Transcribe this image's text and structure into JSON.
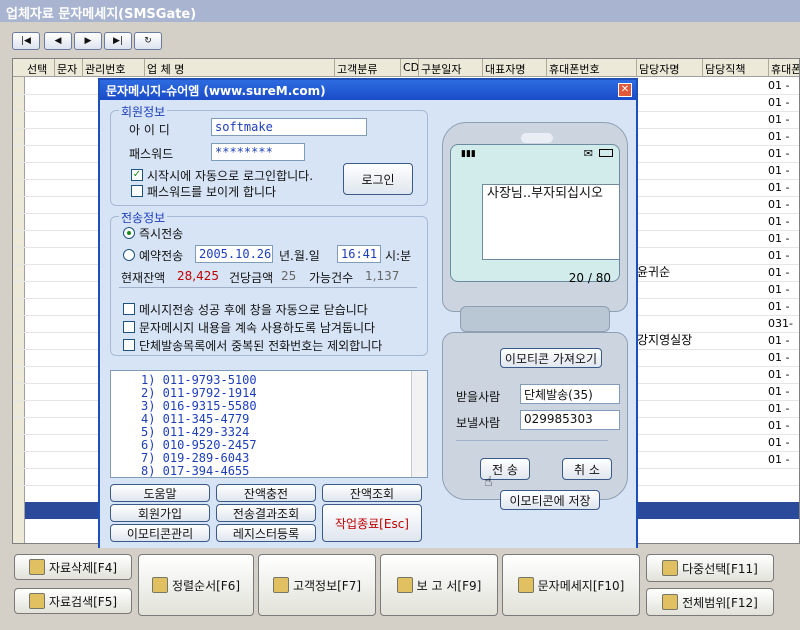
{
  "window": {
    "title": "업체자료 문자메세지(SMSGate)"
  },
  "nav": {
    "first": "|◀",
    "prev": "◀",
    "next": "▶",
    "last": "▶|",
    "refresh": "↻"
  },
  "grid": {
    "columns": [
      "선택",
      "문자",
      "관리번호",
      "업 체 명",
      "고객분류",
      "CD",
      "구분일자",
      "대표자명",
      "휴대폰번호",
      "담당자명",
      "담당직책",
      "휴대폰"
    ],
    "right_col_values": [
      "01 -",
      "01 -",
      "01 -",
      "01 -",
      "01 -",
      "01 -",
      "01 -",
      "01 -",
      "01 -",
      "01 -",
      "01 -",
      "01 -",
      "01 -",
      "01 -",
      "031-",
      "01 -",
      "01 -",
      "01 -",
      "01 -",
      "01 -",
      "01 -",
      "01 -",
      "01 -",
      "01 -"
    ],
    "visible_names": {
      "row_11": "윤귀순",
      "row_15": "강지영실장"
    }
  },
  "dialog": {
    "title": "문자메시지-슈어엠 (www.sureM.com)",
    "member": {
      "group_label": "회원정보",
      "id_label": "아 이 디",
      "id_value": "softmake",
      "pw_label": "패스워드",
      "pw_value": "********",
      "auto_login": "시작시에 자동으로 로그인합니다.",
      "show_pw": "패스워드를 보이게 합니다",
      "login_btn": "로그인"
    },
    "send": {
      "group_label": "전송정보",
      "immediate": "즉시전송",
      "reserve": "예약전송",
      "date": "2005.10.26",
      "date_fmt": "년.월.일",
      "time": "16:41",
      "time_fmt": "시:분",
      "balance_label": "현재잔액",
      "balance": "28,425",
      "unit_label": "건당금액",
      "unit": "25",
      "count_label": "가능건수",
      "count": "1,137",
      "opt1": "메시지전송 성공 후에 창을 자동으로 닫습니다",
      "opt2": "문자메시지 내용을 계속 사용하도록 남겨둡니다",
      "opt3": "단체발송목록에서 중복된 전화번호는 제외합니다"
    },
    "list": [
      "1)   011-9793-5100",
      "2)   011-9792-1914",
      "3)   016-9315-5580",
      "4)   011-345-4779",
      "5)   011-429-3324",
      "6)   010-9520-2457",
      "7)   019-289-6043",
      "8)   017-394-4655"
    ],
    "buttons": {
      "help": "도움말",
      "charge": "잔액충전",
      "balance_query": "잔액조회",
      "join": "회원가입",
      "result_query": "전송결과조회",
      "emoticon_manage": "이모티콘관리",
      "register": "레지스터등록",
      "exit": "작업종료[Esc]"
    },
    "phone": {
      "message": "사장님..부자되십시오",
      "counter": "20 / 80",
      "emoticon_get": "이모티콘 가져오기",
      "recv_label": "받을사람",
      "recv_value": "단체발송(35)",
      "send_label": "보낼사람",
      "send_value": "029985303",
      "send_btn": "전 송",
      "cancel_btn": "취 소",
      "emoticon_save": "이모티콘에 저장"
    }
  },
  "bottom": {
    "delete": "자료삭제[F4]",
    "search": "자료검색[F5]",
    "sort": "정렬순서[F6]",
    "customer": "고객정보[F7]",
    "report": "보 고 서[F9]",
    "sms": "문자메세지[F10]",
    "multi": "다중선택[F11]",
    "range": "전체범위[F12]"
  }
}
